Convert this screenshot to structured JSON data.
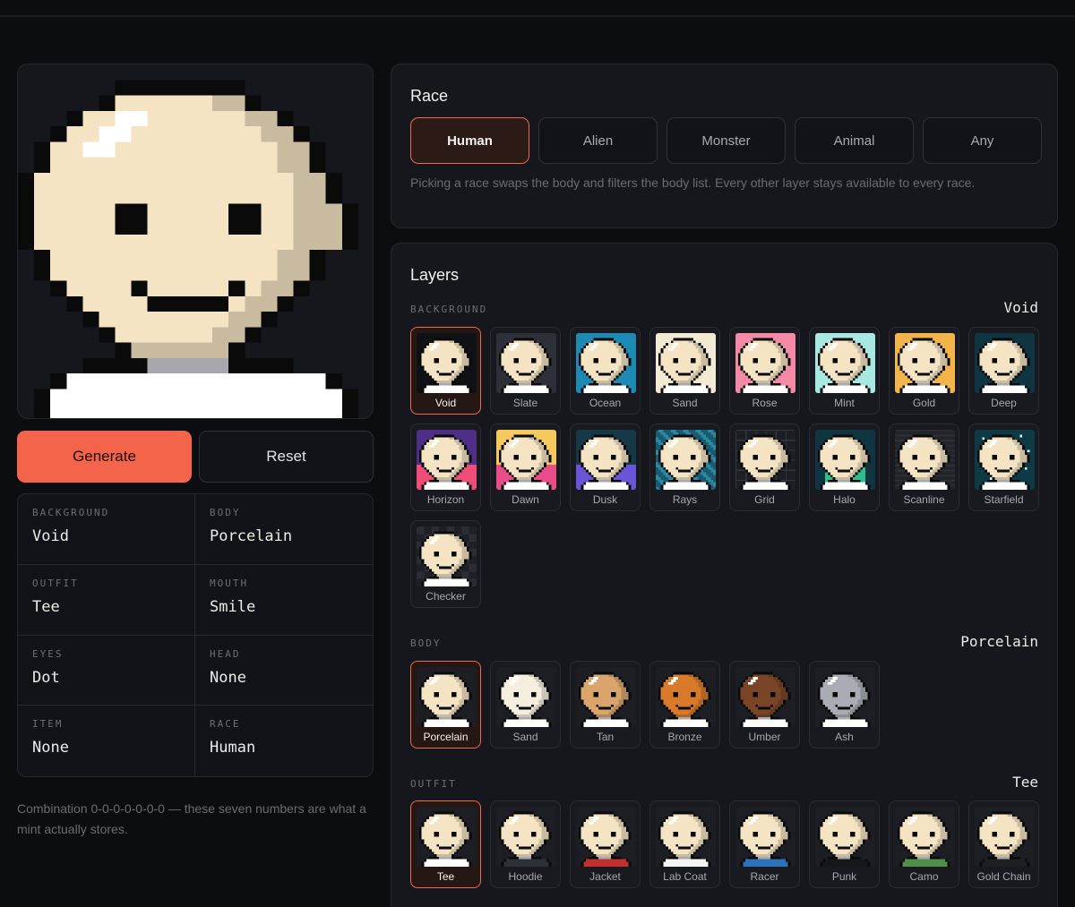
{
  "summary": {
    "cells": [
      {
        "label": "BACKGROUND",
        "value": "Void"
      },
      {
        "label": "BODY",
        "value": "Porcelain"
      },
      {
        "label": "OUTFIT",
        "value": "Tee"
      },
      {
        "label": "MOUTH",
        "value": "Smile"
      },
      {
        "label": "EYES",
        "value": "Dot"
      },
      {
        "label": "HEAD",
        "value": "None"
      },
      {
        "label": "ITEM",
        "value": "None"
      },
      {
        "label": "RACE",
        "value": "Human"
      }
    ]
  },
  "actions": {
    "generate_label": "Generate",
    "reset_label": "Reset"
  },
  "note": "Combination 0-0-0-0-0-0-0 — these seven numbers are what a mint actually stores.",
  "race": {
    "title": "Race",
    "options": [
      "Human",
      "Alien",
      "Monster",
      "Animal",
      "Any"
    ],
    "selected": "Human",
    "hint": "Picking a race swaps the body and filters the body list. Every other layer stays available to every race."
  },
  "layers": {
    "title": "Layers",
    "background": {
      "label": "BACKGROUND",
      "selected": "Void",
      "items": [
        {
          "name": "Void",
          "bg": "#101115"
        },
        {
          "name": "Slate",
          "bg": "#2d3038"
        },
        {
          "name": "Ocean",
          "bg": "#1d8ab3"
        },
        {
          "name": "Sand",
          "bg": "#f3ead4"
        },
        {
          "name": "Rose",
          "bg": "#f48aa6"
        },
        {
          "name": "Mint",
          "bg": "#a8e8e2"
        },
        {
          "name": "Gold",
          "bg": "#f3b44a"
        },
        {
          "name": "Deep",
          "bg": "#0f3442"
        },
        {
          "name": "Horizon",
          "bg": "#4f2f86"
        },
        {
          "name": "Dawn",
          "bg": "#f6c95c"
        },
        {
          "name": "Dusk",
          "bg": "#173847"
        },
        {
          "name": "Rays",
          "bg": "#1a5a6e"
        },
        {
          "name": "Grid",
          "bg": "#1d1e23"
        },
        {
          "name": "Halo",
          "bg": "#103540"
        },
        {
          "name": "Scanline",
          "bg": "#22242a"
        },
        {
          "name": "Starfield",
          "bg": "#0d3a45"
        },
        {
          "name": "Checker",
          "bg": "#1f2026"
        }
      ]
    },
    "body": {
      "label": "BODY",
      "selected": "Porcelain",
      "items": [
        {
          "name": "Porcelain",
          "skin": "#f4e4c3"
        },
        {
          "name": "Sand",
          "skin": "#f6efe0"
        },
        {
          "name": "Tan",
          "skin": "#d9a56c"
        },
        {
          "name": "Bronze",
          "skin": "#d97a2b"
        },
        {
          "name": "Umber",
          "skin": "#7a4526"
        },
        {
          "name": "Ash",
          "skin": "#a9acb4"
        }
      ]
    },
    "outfit": {
      "label": "OUTFIT",
      "selected": "Tee",
      "items": [
        {
          "name": "Tee",
          "color": "#ffffff"
        },
        {
          "name": "Hoodie",
          "color": "#2e3038"
        },
        {
          "name": "Jacket",
          "color": "#c2302e"
        },
        {
          "name": "Lab Coat",
          "color": "#f4f4f4"
        },
        {
          "name": "Racer",
          "color": "#2d6fb8"
        },
        {
          "name": "Punk",
          "color": "#16171b"
        },
        {
          "name": "Camo",
          "color": "#4f8f4a"
        },
        {
          "name": "Gold Chain",
          "color": "#1d1e22"
        }
      ]
    }
  }
}
